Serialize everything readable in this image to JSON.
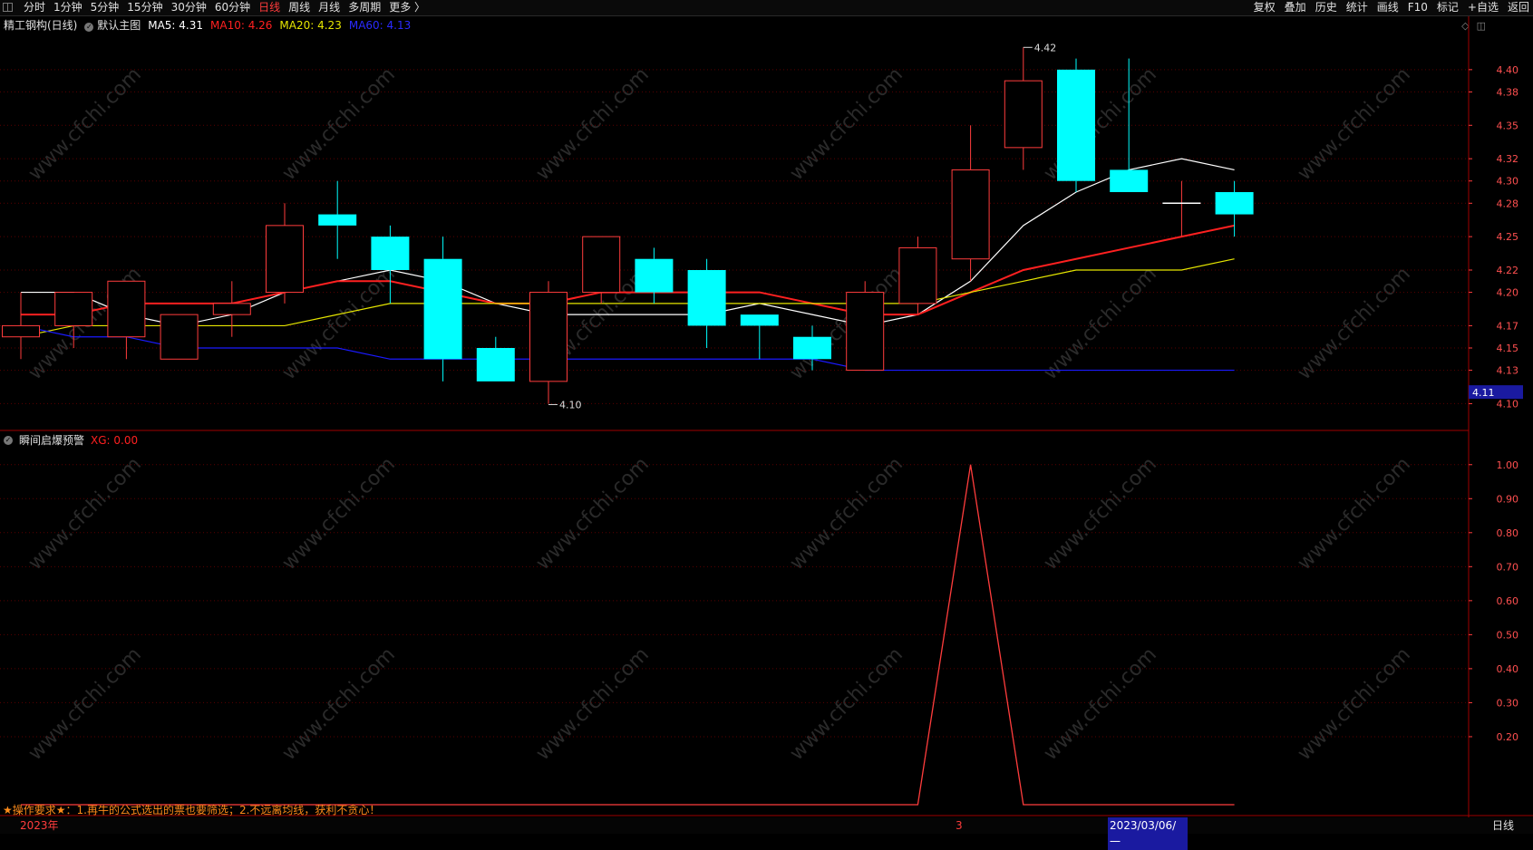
{
  "topbar": {
    "tabs": [
      {
        "label": "分时",
        "active": false
      },
      {
        "label": "1分钟",
        "active": false
      },
      {
        "label": "5分钟",
        "active": false
      },
      {
        "label": "15分钟",
        "active": false
      },
      {
        "label": "30分钟",
        "active": false
      },
      {
        "label": "60分钟",
        "active": false
      },
      {
        "label": "日线",
        "active": true
      },
      {
        "label": "周线",
        "active": false
      },
      {
        "label": "月线",
        "active": false
      },
      {
        "label": "多周期",
        "active": false
      },
      {
        "label": "更多 〉",
        "active": false
      }
    ],
    "tools": [
      "复权",
      "叠加",
      "历史",
      "统计",
      "画线",
      "F10",
      "标记",
      "+自选",
      "返回"
    ]
  },
  "main_title": {
    "stock": "精工钢构(日线)",
    "template": "默认主图",
    "ma5": "MA5: 4.31",
    "ma10": "MA10: 4.26",
    "ma20": "MA20: 4.23",
    "ma60": "MA60: 4.13"
  },
  "indicator_title": {
    "name": "瞬间启爆预警",
    "value": "XG: 0.00"
  },
  "annotations": {
    "high_label": "4.42",
    "low_label": "4.10",
    "price_tag": "4.11"
  },
  "notice": "★操作要求★：1.再牛的公式选出的票也要筛选；2.不远离均线，获利不贪心！",
  "bottom": {
    "year_label": "2023年",
    "marker_label": "3",
    "cursor_date": "2023/03/06/一",
    "period_label": "日线"
  },
  "watermark": "www.cfchi.com",
  "colors": {
    "up": "#ff3c3c",
    "down": "#00ffff",
    "ma5": "#ffffff",
    "ma10": "#ff2020",
    "ma20": "#e6e600",
    "ma60": "#1a1aff",
    "axis": "#ff3c3c"
  },
  "chart_data": [
    {
      "type": "candlestick",
      "title": "精工钢构(日线)",
      "ylim": [
        4.08,
        4.43
      ],
      "y_ticks": [
        4.1,
        4.13,
        4.15,
        4.17,
        4.2,
        4.22,
        4.25,
        4.28,
        4.3,
        4.32,
        4.35,
        4.38,
        4.4
      ],
      "candles": [
        {
          "o": 4.16,
          "h": 4.2,
          "l": 4.14,
          "c": 4.17
        },
        {
          "o": 4.17,
          "h": 4.2,
          "l": 4.15,
          "c": 4.2
        },
        {
          "o": 4.16,
          "h": 4.21,
          "l": 4.14,
          "c": 4.21
        },
        {
          "o": 4.14,
          "h": 4.18,
          "l": 4.14,
          "c": 4.18
        },
        {
          "o": 4.18,
          "h": 4.21,
          "l": 4.16,
          "c": 4.19
        },
        {
          "o": 4.2,
          "h": 4.28,
          "l": 4.19,
          "c": 4.26
        },
        {
          "o": 4.27,
          "h": 4.3,
          "l": 4.23,
          "c": 4.26
        },
        {
          "o": 4.25,
          "h": 4.26,
          "l": 4.19,
          "c": 4.22
        },
        {
          "o": 4.23,
          "h": 4.25,
          "l": 4.12,
          "c": 4.14
        },
        {
          "o": 4.15,
          "h": 4.16,
          "l": 4.12,
          "c": 4.12
        },
        {
          "o": 4.12,
          "h": 4.21,
          "l": 4.1,
          "c": 4.2
        },
        {
          "o": 4.2,
          "h": 4.25,
          "l": 4.19,
          "c": 4.25
        },
        {
          "o": 4.23,
          "h": 4.24,
          "l": 4.19,
          "c": 4.2
        },
        {
          "o": 4.22,
          "h": 4.23,
          "l": 4.15,
          "c": 4.17
        },
        {
          "o": 4.18,
          "h": 4.18,
          "l": 4.14,
          "c": 4.17
        },
        {
          "o": 4.16,
          "h": 4.17,
          "l": 4.13,
          "c": 4.14
        },
        {
          "o": 4.13,
          "h": 4.21,
          "l": 4.13,
          "c": 4.2
        },
        {
          "o": 4.19,
          "h": 4.25,
          "l": 4.18,
          "c": 4.24
        },
        {
          "o": 4.23,
          "h": 4.35,
          "l": 4.21,
          "c": 4.31
        },
        {
          "o": 4.33,
          "h": 4.42,
          "l": 4.31,
          "c": 4.39
        },
        {
          "o": 4.4,
          "h": 4.41,
          "l": 4.29,
          "c": 4.3
        },
        {
          "o": 4.31,
          "h": 4.41,
          "l": 4.29,
          "c": 4.29
        },
        {
          "o": 4.28,
          "h": 4.3,
          "l": 4.25,
          "c": 4.28
        },
        {
          "o": 4.29,
          "h": 4.3,
          "l": 4.25,
          "c": 4.27
        }
      ],
      "series": [
        {
          "name": "MA5",
          "values": [
            4.2,
            4.2,
            4.18,
            4.17,
            4.18,
            4.2,
            4.21,
            4.22,
            4.21,
            4.19,
            4.18,
            4.18,
            4.18,
            4.18,
            4.19,
            4.18,
            4.17,
            4.18,
            4.21,
            4.26,
            4.29,
            4.31,
            4.32,
            4.31
          ]
        },
        {
          "name": "MA10",
          "values": [
            4.18,
            4.18,
            4.19,
            4.19,
            4.19,
            4.2,
            4.21,
            4.21,
            4.2,
            4.19,
            4.19,
            4.2,
            4.2,
            4.2,
            4.2,
            4.19,
            4.18,
            4.18,
            4.2,
            4.22,
            4.23,
            4.24,
            4.25,
            4.26
          ]
        },
        {
          "name": "MA20",
          "values": [
            4.16,
            4.17,
            4.17,
            4.17,
            4.17,
            4.17,
            4.18,
            4.19,
            4.19,
            4.19,
            4.19,
            4.19,
            4.19,
            4.19,
            4.19,
            4.19,
            4.19,
            4.19,
            4.2,
            4.21,
            4.22,
            4.22,
            4.22,
            4.23
          ]
        },
        {
          "name": "MA60",
          "values": [
            4.17,
            4.16,
            4.16,
            4.15,
            4.15,
            4.15,
            4.15,
            4.14,
            4.14,
            4.14,
            4.14,
            4.14,
            4.14,
            4.14,
            4.14,
            4.14,
            4.13,
            4.13,
            4.13,
            4.13,
            4.13,
            4.13,
            4.13,
            4.13
          ]
        }
      ]
    },
    {
      "type": "line",
      "title": "瞬间启爆预警",
      "ylim": [
        0,
        1.05
      ],
      "y_ticks": [
        0.2,
        0.3,
        0.4,
        0.5,
        0.6,
        0.7,
        0.8,
        0.9,
        1.0
      ],
      "series": [
        {
          "name": "XG",
          "values": [
            0,
            0,
            0,
            0,
            0,
            0,
            0,
            0,
            0,
            0,
            0,
            0,
            0,
            0,
            0,
            0,
            0,
            0,
            1,
            0,
            0,
            0,
            0,
            0
          ]
        }
      ]
    }
  ]
}
